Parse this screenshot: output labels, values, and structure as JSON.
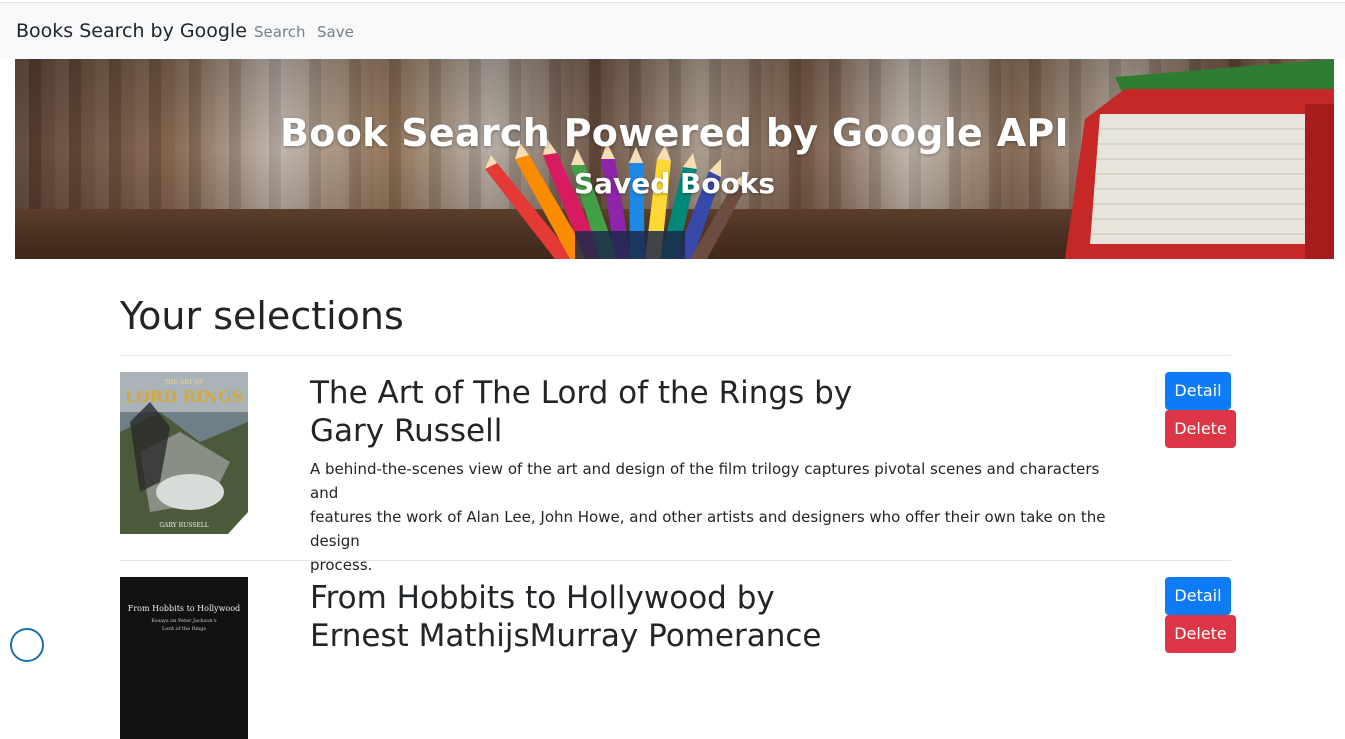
{
  "navbar": {
    "brand": "Books Search by Google",
    "links": [
      "Search",
      "Save"
    ]
  },
  "hero": {
    "title": "Book Search Powered by Google API",
    "subtitle": "Saved Books"
  },
  "section": {
    "title": "Your selections"
  },
  "books": [
    {
      "title_line1": "The Art of The Lord of the Rings by",
      "title_line2": "Gary Russell",
      "description_lines": [
        "A behind-the-scenes view of the art and design of the film trilogy captures pivotal scenes and characters and",
        "features the work of Alan Lee, John Howe, and other artists and designers who offer their own take on the design",
        "process."
      ],
      "cover": {
        "top_text": "THE ART OF",
        "logo_text": "LORD RINGS",
        "author_text": "GARY RUSSELL"
      },
      "detail_label": "Detail",
      "delete_label": "Delete"
    },
    {
      "title_line1": "From Hobbits to Hollywood by",
      "title_line2": "Ernest MathijsMurray Pomerance",
      "cover": {
        "line1": "From Hobbits to Hollywood",
        "line2": "Essays on Peter Jackson's",
        "line3": "Lord of the Rings"
      },
      "detail_label": "Detail",
      "delete_label": "Delete"
    }
  ],
  "colors": {
    "primary": "#0d7bf5",
    "danger": "#dc3545",
    "navbar_bg": "#f8f9fa"
  }
}
